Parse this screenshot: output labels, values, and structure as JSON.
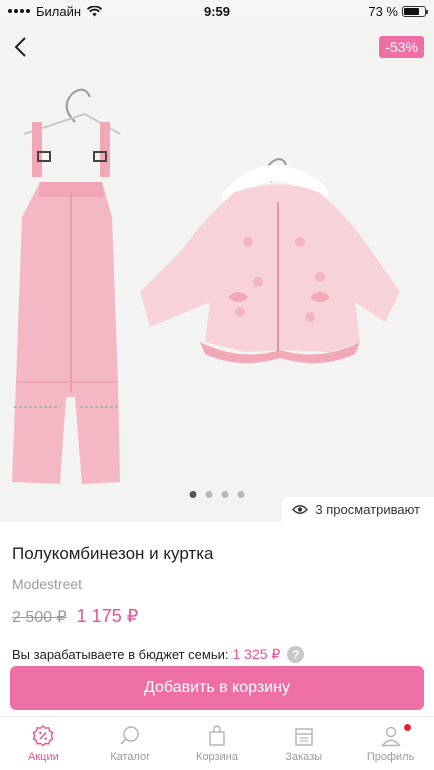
{
  "status_bar": {
    "carrier": "Билайн",
    "time": "9:59",
    "battery": "73 %"
  },
  "product": {
    "discount": "-53%",
    "image_count": 4,
    "active_image": 0,
    "viewers": "3 просматривают",
    "title": "Полукомбинезон и куртка",
    "brand": "Modestreet",
    "old_price": "2 500 ₽",
    "new_price": "1 175 ₽",
    "earn_label": "Вы зарабатываете в бюджет семьи:",
    "earn_amount": "1 325 ₽",
    "help_glyph": "?"
  },
  "actions": {
    "add_to_cart": "Добавить в корзину"
  },
  "tab_bar": {
    "items": [
      {
        "label": "Акции",
        "icon": "percent-icon",
        "active": true
      },
      {
        "label": "Каталог",
        "icon": "search-icon",
        "active": false
      },
      {
        "label": "Корзина",
        "icon": "bag-icon",
        "active": false
      },
      {
        "label": "Заказы",
        "icon": "box-icon",
        "active": false
      },
      {
        "label": "Профиль",
        "icon": "user-icon",
        "active": false,
        "badge": true
      }
    ]
  },
  "colors": {
    "accent": "#ee4f94",
    "button": "#ee6fa5",
    "product_pink": "#f4b8c4"
  }
}
